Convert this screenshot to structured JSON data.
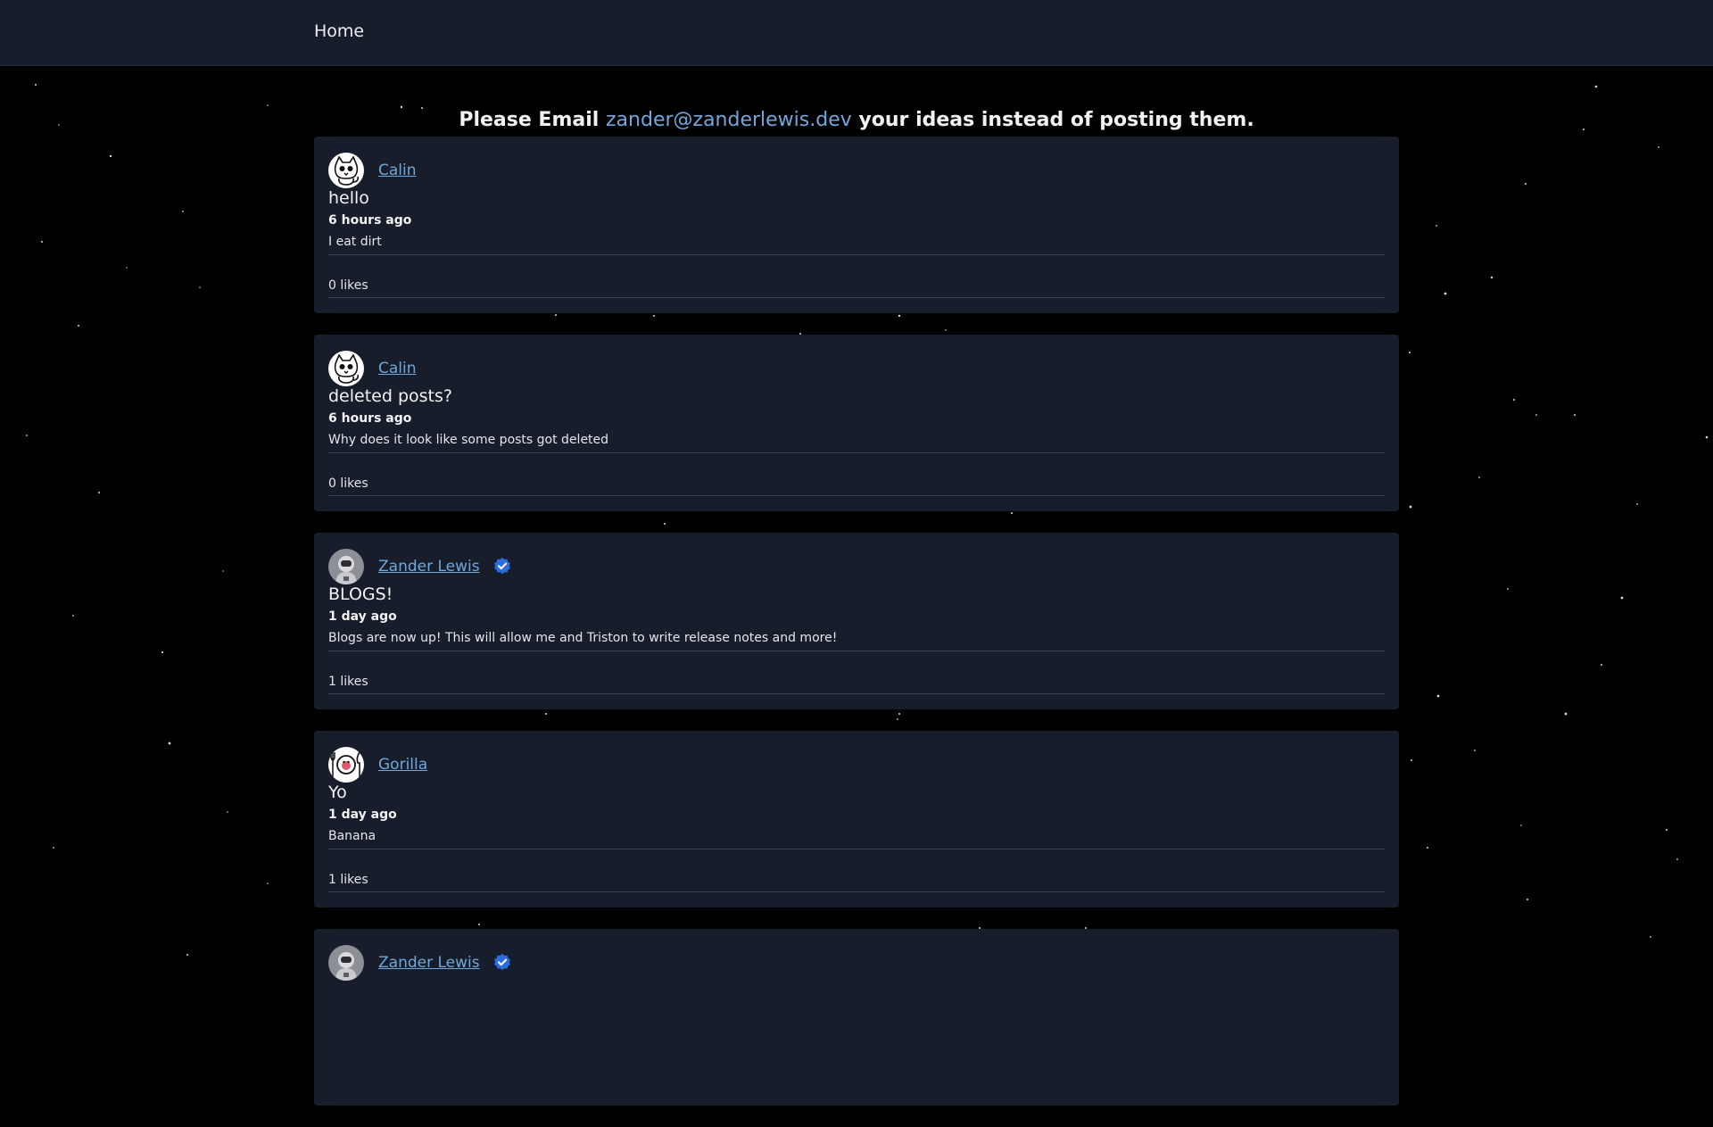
{
  "nav": {
    "home_label": "Home"
  },
  "banner": {
    "prefix": "Please Email",
    "email": "zander@zanderlewis.dev",
    "suffix": "your ideas instead of posting them."
  },
  "posts": [
    {
      "author": "Calin",
      "verified": false,
      "avatar": "cat-avatar-icon",
      "title": "hello",
      "time": "6 hours ago",
      "body": "I eat dirt",
      "likes": "0 likes"
    },
    {
      "author": "Calin",
      "verified": false,
      "avatar": "cat-avatar-icon",
      "title": "deleted posts?",
      "time": "6 hours ago",
      "body": "Why does it look like some posts got deleted",
      "likes": "0 likes"
    },
    {
      "author": "Zander Lewis",
      "verified": true,
      "avatar": "astronaut-avatar-icon",
      "title": "BLOGS!",
      "time": "1 day ago",
      "body": "Blogs are now up! This will allow me and Triston to write release notes and more!",
      "likes": "1 likes"
    },
    {
      "author": "Gorilla",
      "verified": false,
      "avatar": "plate-avatar-icon",
      "title": "Yo",
      "time": "1 day ago",
      "body": "Banana",
      "likes": "1 likes"
    },
    {
      "author": "Zander Lewis",
      "verified": true,
      "avatar": "astronaut-avatar-icon",
      "title": "",
      "time": "",
      "body": "",
      "likes": ""
    }
  ],
  "colors": {
    "link": "#6fa8dc",
    "card": "#171d2a",
    "verified": "#2d6cdf"
  }
}
